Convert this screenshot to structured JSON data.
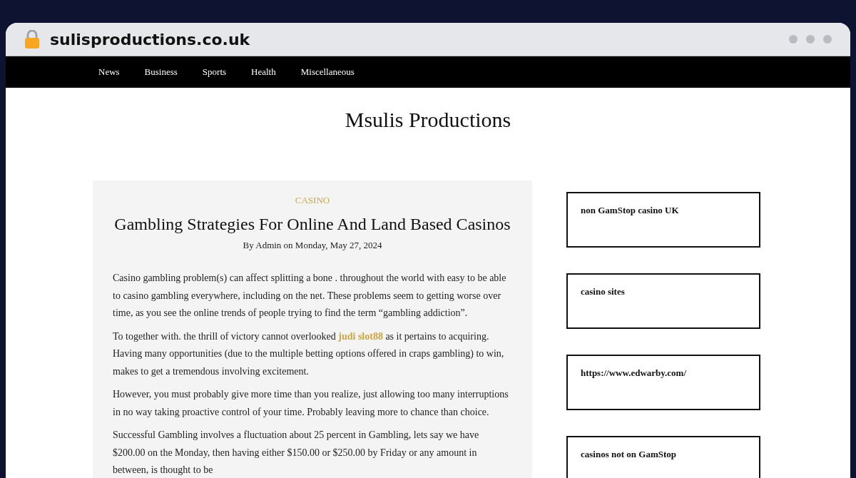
{
  "browser": {
    "url": "sulisproductions.co.uk"
  },
  "nav": {
    "items": [
      {
        "label": "News"
      },
      {
        "label": "Business"
      },
      {
        "label": "Sports"
      },
      {
        "label": "Health"
      },
      {
        "label": "Miscellaneous"
      }
    ]
  },
  "site_title": "Msulis Productions",
  "article": {
    "category": "CASINO",
    "title": "Gambling Strategies For Online And Land Based Casinos",
    "byline": "By Admin on Monday, May 27, 2024",
    "paragraphs": [
      [
        {
          "kind": "text",
          "text": "Casino gambling problem(s) can affect splitting a bone . throughout the world with easy to be able to casino gambling everywhere, including on the net. These problems seem to getting worse over time, as you see the online trends of people trying to find the term “gambling addiction”."
        }
      ],
      [
        {
          "kind": "text",
          "text": "To together with. the thrill of victory cannot overlooked "
        },
        {
          "kind": "link",
          "text": "judi slot88"
        },
        {
          "kind": "text",
          "text": " as it pertains to acquiring. Having many opportunities (due to the multiple betting options offered in craps gambling) to win, makes to get a tremendous involving excitement."
        }
      ],
      [
        {
          "kind": "text",
          "text": "However, you must probably give more time than you realize, just allowing too many interruptions in no way taking proactive control of your time. Probably leaving more to chance than choice."
        }
      ],
      [
        {
          "kind": "text",
          "text": "Successful Gambling involves a fluctuation about 25 percent in Gambling, lets say we have $200.00 on the Monday, then having either $150.00 or $250.00 by Friday or any amount in between, is thought to be"
        }
      ]
    ]
  },
  "sidebar": {
    "widgets": [
      {
        "label": "non GamStop casino UK"
      },
      {
        "label": "casino sites"
      },
      {
        "label": "https://www.edwarby.com/"
      },
      {
        "label": "casinos not on GamStop"
      }
    ]
  }
}
